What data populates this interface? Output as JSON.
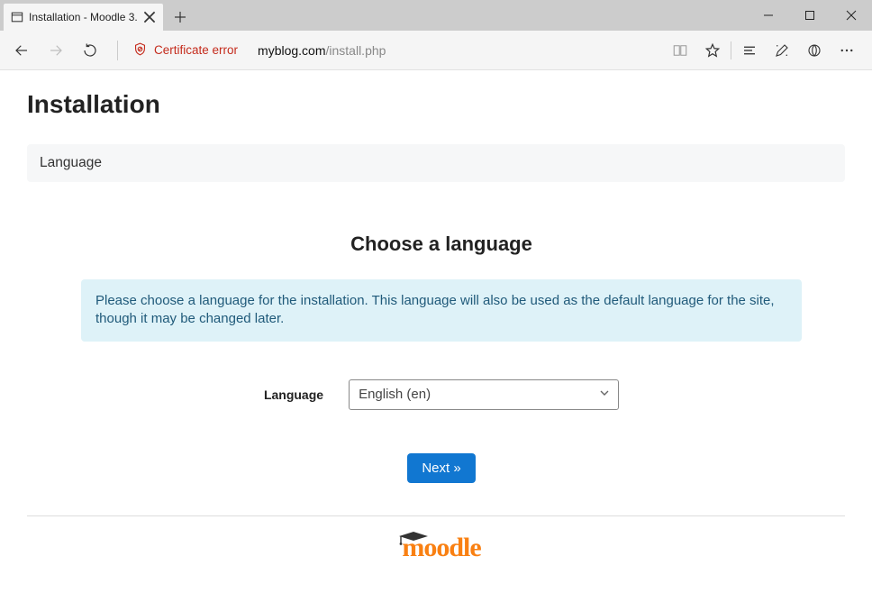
{
  "browser": {
    "tab_title": "Installation - Moodle 3.",
    "certificate_error": "Certificate error",
    "url_host": "myblog.com",
    "url_path": "/install.php"
  },
  "page": {
    "title": "Installation",
    "breadcrumb": "Language",
    "heading": "Choose a language",
    "info": "Please choose a language for the installation. This language will also be used as the default language for the site, though it may be changed later.",
    "language_label": "Language",
    "language_value": "English (en)",
    "next_label": "Next »",
    "logo_text": "moodle"
  }
}
